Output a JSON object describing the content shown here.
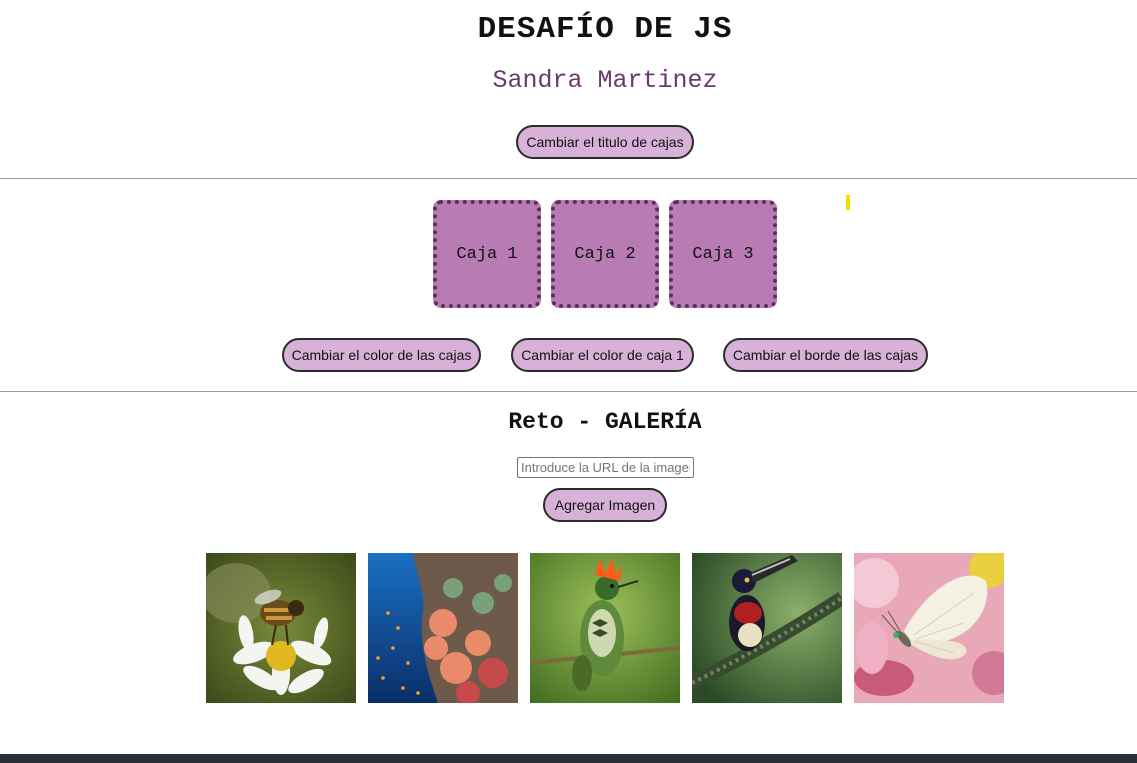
{
  "header": {
    "title": "DESAFÍO DE JS",
    "author": "Sandra Martinez",
    "change_title_button": "Cambiar el titulo de cajas"
  },
  "boxes": {
    "items": [
      "Caja 1",
      "Caja 2",
      "Caja 3"
    ],
    "change_color_button": "Cambiar el color de las cajas",
    "change_color_box1_button": "Cambiar el color de caja 1",
    "change_border_button": "Cambiar el borde de las cajas"
  },
  "gallery": {
    "title": "Reto - GALERÍA",
    "url_input": {
      "placeholder": "Introduce la URL de la imagen",
      "value": ""
    },
    "add_button": "Agregar Imagen",
    "images": [
      {
        "name": "bee-on-flower-image"
      },
      {
        "name": "coral-reef-image"
      },
      {
        "name": "hummingbird-image"
      },
      {
        "name": "toucan-bird-image"
      },
      {
        "name": "white-butterfly-image"
      }
    ]
  },
  "colors": {
    "accent_button": "#d8b1d9",
    "box_fill": "#b87bb3",
    "author_text": "#6a3a6c",
    "footer": "#2b2d3a"
  }
}
